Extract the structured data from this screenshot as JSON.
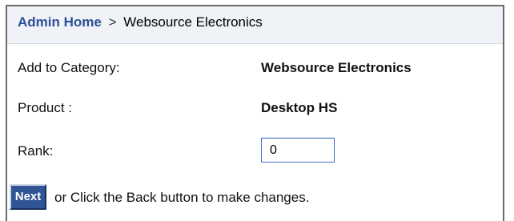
{
  "breadcrumb": {
    "home_link": "Admin Home",
    "separator": ">",
    "current": "Websource Electronics"
  },
  "form": {
    "category_label": "Add to Category:",
    "category_value": "Websource Electronics",
    "product_label": "Product :",
    "product_value": "Desktop HS",
    "rank_label": "Rank:",
    "rank_value": "0"
  },
  "actions": {
    "next_label": "Next",
    "next_note": "or Click the Back button to make changes."
  },
  "colors": {
    "link": "#2c4f96",
    "header_background": "#eff2f6",
    "button_background": "#2f5596",
    "input_border": "#3f6fc9"
  }
}
